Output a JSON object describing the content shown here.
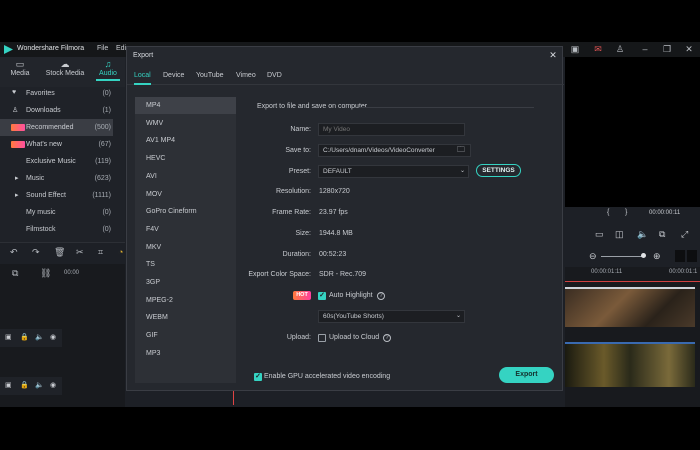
{
  "app": {
    "title": "Wondershare Filmora",
    "menu": [
      "File",
      "Edi"
    ]
  },
  "left_tabs": [
    {
      "label": "Media",
      "icon": "folder-icon",
      "active": false
    },
    {
      "label": "Stock Media",
      "icon": "cloud-icon",
      "active": false
    },
    {
      "label": "Audio",
      "icon": "music-note-icon",
      "active": true
    }
  ],
  "library": [
    {
      "label": "Favorites",
      "count": "(0)",
      "icon": "heart-icon"
    },
    {
      "label": "Downloads",
      "count": "(1)",
      "icon": "user-icon"
    },
    {
      "label": "Recommended",
      "count": "(500)",
      "icon": "hot-badge-icon",
      "selected": true
    },
    {
      "label": "What's new",
      "count": "(67)",
      "icon": "hot-badge-icon"
    },
    {
      "label": "Exclusive Music",
      "count": "(119)",
      "icon": ""
    },
    {
      "label": "Music",
      "count": "(623)",
      "icon": "caret-right-icon"
    },
    {
      "label": "Sound Effect",
      "count": "(1111)",
      "icon": "caret-right-icon"
    },
    {
      "label": "My music",
      "count": "(0)",
      "icon": ""
    },
    {
      "label": "Filmstock",
      "count": "(0)",
      "icon": ""
    }
  ],
  "timeline": {
    "start_time": "00:00",
    "preview_time": "00:00:00:11",
    "ruler": [
      "00:00:01:11",
      "00:00:01:1"
    ]
  },
  "dialog": {
    "title": "Export",
    "tabs": [
      "Local",
      "Device",
      "YouTube",
      "Vimeo",
      "DVD"
    ],
    "active_tab": "Local",
    "formats": [
      "MP4",
      "WMV",
      "AV1 MP4",
      "HEVC",
      "AVI",
      "MOV",
      "GoPro Cineform",
      "F4V",
      "MKV",
      "TS",
      "3GP",
      "MPEG-2",
      "WEBM",
      "GIF",
      "MP3"
    ],
    "selected_format": "MP4",
    "section_title": "Export to file and save on computer",
    "fields": {
      "name_label": "Name:",
      "name_placeholder": "My Video",
      "save_label": "Save to:",
      "save_value": "C:/Users/dnam/Videos/VideoConverter",
      "preset_label": "Preset:",
      "preset_value": "DEFAULT",
      "settings_label": "SETTINGS",
      "resolution_label": "Resolution:",
      "resolution_value": "1280x720",
      "framerate_label": "Frame Rate:",
      "framerate_value": "23.97 fps",
      "size_label": "Size:",
      "size_value": "1944.8 MB",
      "duration_label": "Duration:",
      "duration_value": "00:52:23",
      "colorspace_label": "Export Color Space:",
      "colorspace_value": "SDR - Rec.709",
      "hot_tag": "HOT",
      "auto_highlight_label": "Auto Highlight",
      "auto_highlight_checked": true,
      "highlight_duration": "60s(YouTube Shorts)",
      "upload_label": "Upload:",
      "upload_cloud_label": "Upload to Cloud",
      "upload_cloud_checked": false
    },
    "gpu_label": "Enable GPU accelerated video encoding",
    "gpu_checked": true,
    "export_button": "Export"
  },
  "colors": {
    "accent": "#35d3c2",
    "dialog_bg": "#25282e",
    "app_bg": "#1d2026"
  }
}
